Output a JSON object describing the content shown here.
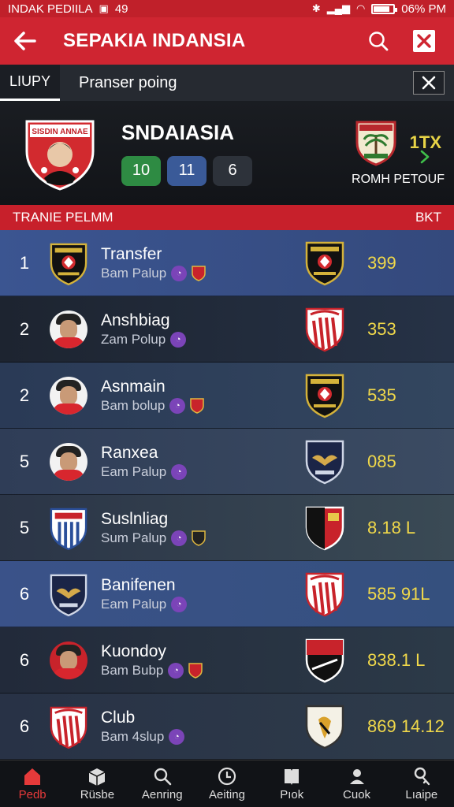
{
  "status_bar": {
    "left_text": "INDAK PEDIILA",
    "left_number": "49",
    "battery_text": "06% PM"
  },
  "app_bar": {
    "title": "SEPAKIA INDANSIA"
  },
  "tabs": {
    "main": "LIUPY",
    "second": "Pranser poing"
  },
  "header": {
    "badge_text": "SISDIN ANNAE",
    "name": "SNDAIASIA",
    "pills": [
      "10",
      "11",
      "6"
    ],
    "rank_label": "1TX",
    "caption": "ROMH PETOUF"
  },
  "section": {
    "left": "TRANIE PELMM",
    "right": "BKT"
  },
  "colors": {
    "accent_red": "#cf2531",
    "value_yellow": "#f0d84a",
    "pill_green": "#2e8b43",
    "pill_blue": "#3a5a98"
  },
  "rows": [
    {
      "rank": "1",
      "name": "Transfer",
      "sub": "Bam Palup",
      "value": "399",
      "avatar": "club-black",
      "club": "club-black"
    },
    {
      "rank": "2",
      "name": "Anshbiag",
      "sub": "Zam Polup",
      "value": "353",
      "avatar": "player",
      "club": "club-redwhite"
    },
    {
      "rank": "2",
      "name": "Asnmain",
      "sub": "Bam bolup",
      "value": "535",
      "avatar": "player",
      "club": "club-black"
    },
    {
      "rank": "5",
      "name": "Ranxea",
      "sub": "Eam Palup",
      "value": "085",
      "avatar": "player",
      "club": "club-eagle"
    },
    {
      "rank": "5",
      "name": "Suslnliag",
      "sub": "Sum Palup",
      "value": "8.18 L",
      "avatar": "club-bluewhite",
      "club": "club-redblack"
    },
    {
      "rank": "6",
      "name": "Banifenen",
      "sub": "Eam Palup",
      "value": "585 91L",
      "avatar": "club-eagle",
      "club": "club-redwhite"
    },
    {
      "rank": "6",
      "name": "Kuondoy",
      "sub": "Bam Bubp",
      "value": "838.1 L",
      "avatar": "player-red",
      "club": "club-redblack2"
    },
    {
      "rank": "6",
      "name": "Club",
      "sub": "Bam 4slup",
      "value": "869 14.12",
      "avatar": "club-redwhite",
      "club": "club-white"
    }
  ],
  "bottom_nav": [
    {
      "label": "Pedb",
      "icon": "home-icon",
      "active": true
    },
    {
      "label": "Rüsbe",
      "icon": "box-icon",
      "active": false
    },
    {
      "label": "Aenring",
      "icon": "search-icon",
      "active": false
    },
    {
      "label": "Aeiting",
      "icon": "clock-icon",
      "active": false
    },
    {
      "label": "Pıok",
      "icon": "book-icon",
      "active": false
    },
    {
      "label": "Cuok",
      "icon": "person-icon",
      "active": false
    },
    {
      "label": "Lıaipe",
      "icon": "key-icon",
      "active": false
    }
  ]
}
